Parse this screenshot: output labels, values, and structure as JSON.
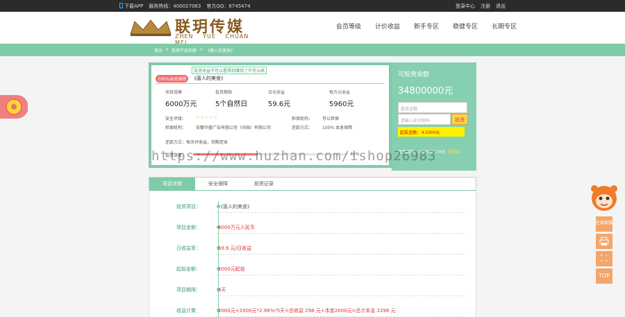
{
  "topbar": {
    "download": "下载APP",
    "hotline": "服务热线：400027063",
    "qq": "官方QQ：6745474",
    "links": [
      "登录中心",
      "注册",
      "退出"
    ]
  },
  "logo": {
    "cn": "联玥传媒",
    "en": "ZHEN YUE CHUAN MEI"
  },
  "nav": [
    "会员等级",
    "计价收益",
    "新手专区",
    "稳健专区",
    "长期专区"
  ],
  "breadcrumb": [
    "首页",
    ">",
    "投资产品列表",
    ">",
    "《唐人的美食》"
  ],
  "project": {
    "tag": "100%本息保障",
    "link_text": "投资收益不可以看得到赚钱了不可以高",
    "title": "《唐人的美食》",
    "stats": [
      {
        "label": "项目规模",
        "value": "6000万元"
      },
      {
        "label": "投资期限",
        "value": "5个自然日"
      },
      {
        "label": "日化收益",
        "value": "59.6元"
      },
      {
        "label": "每万元收益",
        "value": "5960元"
      }
    ],
    "info_rows": [
      [
        "安全评级：",
        "☆☆☆☆☆",
        "担保机构：",
        "可以担保"
      ],
      [
        "担保机构：",
        "安徽华盛广告有限公司（中国）有限公司",
        "还款方式：",
        "100% 本息保障"
      ]
    ],
    "repay_note": "还款方式：每天付收益，到期还本",
    "progress_label": "投资进度：",
    "progress": 0.42,
    "progress_pct": "42%"
  },
  "invest": {
    "title": "可投资余额",
    "amount": "34800000元",
    "amount_placeholder": "投资金额",
    "password_placeholder": "请输入支付密码",
    "button": "投资",
    "min_hint": "起投金额：￥2000元",
    "balance": "可用余额：986995.74元",
    "recharge": "【充值】"
  },
  "tabs": [
    "项目详情",
    "安全保障",
    "投资记录"
  ],
  "details": [
    {
      "label": "投资项目：",
      "value": "《唐人的美食》",
      "red": false
    },
    {
      "label": "项目金额：",
      "value": "6000万元人民币",
      "red": true
    },
    {
      "label": "日收益率：",
      "value": "59.6 元/日收益",
      "red": true
    },
    {
      "label": "起投金额：",
      "value": "2000元起投",
      "red": true
    },
    {
      "label": "项目期限：",
      "value": "5天",
      "red": true
    },
    {
      "label": "收益计算：",
      "value": "2000元+2000元*2.98%*5天=总收益 298 元+本金2000元=总计本息 2298 元",
      "red": true
    }
  ],
  "float": {
    "service": "在线客服",
    "calc": "+ −\n× =",
    "top": "TOP"
  },
  "watermark": "https://www.huzhan.com/ishop26983"
}
